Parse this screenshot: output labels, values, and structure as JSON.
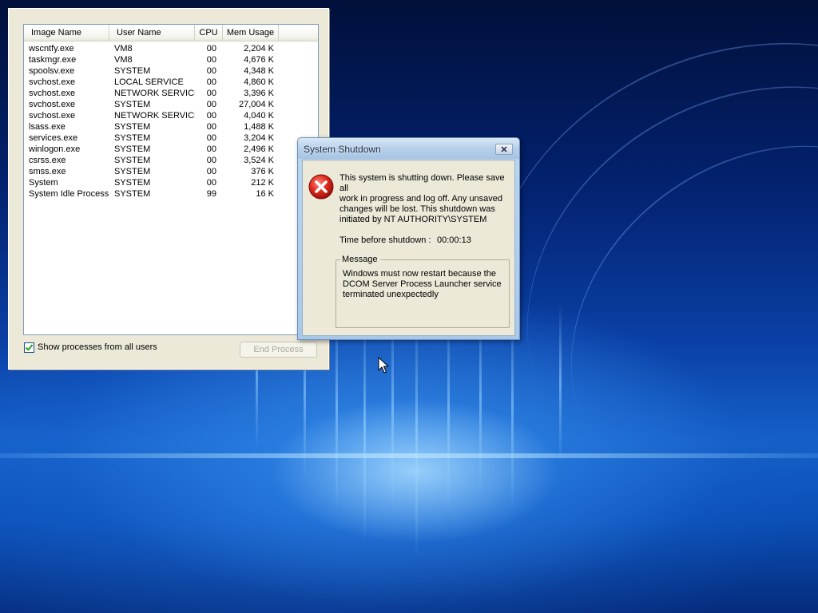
{
  "task_manager": {
    "columns": {
      "image_name": "Image Name",
      "user_name": "User Name",
      "cpu": "CPU",
      "mem_usage": "Mem Usage"
    },
    "processes": [
      {
        "name": "wscntfy.exe",
        "user": "VM8",
        "cpu": "00",
        "mem": "2,204 K"
      },
      {
        "name": "taskmgr.exe",
        "user": "VM8",
        "cpu": "00",
        "mem": "4,676 K"
      },
      {
        "name": "spoolsv.exe",
        "user": "SYSTEM",
        "cpu": "00",
        "mem": "4,348 K"
      },
      {
        "name": "svchost.exe",
        "user": "LOCAL SERVICE",
        "cpu": "00",
        "mem": "4,860 K"
      },
      {
        "name": "svchost.exe",
        "user": "NETWORK SERVICE",
        "cpu": "00",
        "mem": "3,396 K"
      },
      {
        "name": "svchost.exe",
        "user": "SYSTEM",
        "cpu": "00",
        "mem": "27,004 K"
      },
      {
        "name": "svchost.exe",
        "user": "NETWORK SERVICE",
        "cpu": "00",
        "mem": "4,040 K"
      },
      {
        "name": "lsass.exe",
        "user": "SYSTEM",
        "cpu": "00",
        "mem": "1,488 K"
      },
      {
        "name": "services.exe",
        "user": "SYSTEM",
        "cpu": "00",
        "mem": "3,204 K"
      },
      {
        "name": "winlogon.exe",
        "user": "SYSTEM",
        "cpu": "00",
        "mem": "2,496 K"
      },
      {
        "name": "csrss.exe",
        "user": "SYSTEM",
        "cpu": "00",
        "mem": "3,524 K"
      },
      {
        "name": "smss.exe",
        "user": "SYSTEM",
        "cpu": "00",
        "mem": "376 K"
      },
      {
        "name": "System",
        "user": "SYSTEM",
        "cpu": "00",
        "mem": "212 K"
      },
      {
        "name": "System Idle Process",
        "user": "SYSTEM",
        "cpu": "99",
        "mem": "16 K"
      }
    ],
    "show_all_label": "Show processes from all users",
    "show_all_checked": true,
    "end_process_label": "End Process"
  },
  "shutdown_dialog": {
    "title": "System Shutdown",
    "close_icon": "close-icon",
    "error_icon": "error-icon",
    "message_lines": [
      "This system is shutting down. Please save all",
      "work in progress and log off. Any unsaved",
      "changes will be lost. This shutdown was",
      "initiated by NT AUTHORITY\\SYSTEM"
    ],
    "time_label": "Time before shutdown :",
    "time_value": "00:00:13",
    "message_legend": "Message",
    "reason_lines": [
      "Windows must now restart because the",
      "DCOM Server Process Launcher service",
      "terminated unexpectedly"
    ]
  },
  "colors": {
    "desktop_dark": "#01103a",
    "desktop_glow": "#1560c8",
    "dialog_frame": "#a9c8e8",
    "dialog_face": "#ece9d8",
    "error_red": "#d81e1e"
  }
}
